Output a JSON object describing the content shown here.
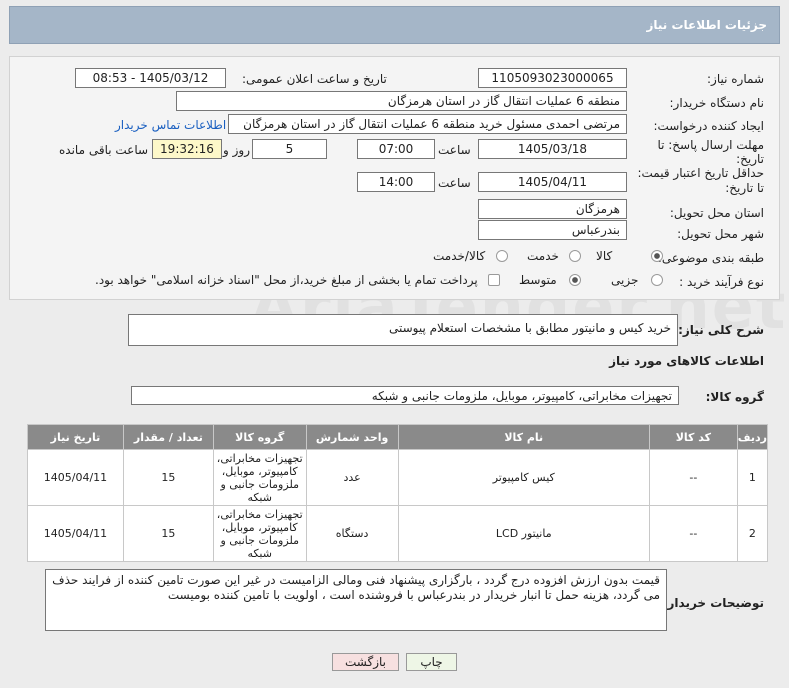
{
  "header": {
    "title": "جزئیات اطلاعات نیاز"
  },
  "form": {
    "need_number_label": "شماره نیاز:",
    "need_number": "1105093023000065",
    "announce_label": "تاریخ و ساعت اعلان عمومی:",
    "announce_value": "1405/03/12 - 08:53",
    "buyer_org_label": "نام دستگاه خریدار:",
    "buyer_org": "منطقه 6 عملیات انتقال گاز در استان هرمزگان",
    "creator_label": "ایجاد کننده درخواست:",
    "creator": "مرتضی احمدی مسئول خرید منطقه 6 عملیات انتقال گاز در استان هرمزگان",
    "contact_link": "اطلاعات تماس خریدار",
    "reply_label_1": "مهلت ارسال پاسخ: تا",
    "reply_label_2": "تاریخ:",
    "reply_date": "1405/03/18",
    "time_label": "ساعت",
    "reply_time": "07:00",
    "days_value": "5",
    "days_label": "روز و",
    "remaining_time": "19:32:16",
    "remaining_label": "ساعت باقی مانده",
    "validity_label_1": "حداقل تاریخ اعتبار قیمت:",
    "validity_label_2": "تا تاریخ:",
    "validity_date": "1405/04/11",
    "validity_time": "14:00",
    "province_label": "استان محل تحویل:",
    "province": "هرمزگان",
    "city_label": "شهر محل تحویل:",
    "city": "بندرعباس",
    "category_label": "طبقه بندی موضوعی:",
    "category_options": [
      "کالا",
      "خدمت",
      "کالا/خدمت"
    ],
    "process_label": "نوع فرآیند خرید :",
    "process_options": [
      "جزیی",
      "متوسط"
    ],
    "payment_note": "پرداخت تمام یا بخشی از مبلغ خرید،از محل \"اسناد خزانه اسلامی\" خواهد بود."
  },
  "summary": {
    "label": "شرح کلی نیاز:",
    "text": "خرید کیس و مانیتور مطابق با مشخصات استعلام پیوستی"
  },
  "goods_info": {
    "title": "اطلاعات کالاهای مورد نیاز",
    "group_label": "گروه کالا:",
    "group_value": "تجهیزات مخابراتی، کامپیوتر، موبایل، ملزومات جانبی و شبکه"
  },
  "table": {
    "headers": [
      "ردیف",
      "کد کالا",
      "نام کالا",
      "واحد شمارش",
      "گروه کالا",
      "تعداد / مقدار",
      "تاریخ نیاز"
    ],
    "rows": [
      {
        "row": "1",
        "code": "--",
        "name": "کیس کامپیوتر",
        "unit": "عدد",
        "group": "تجهیزات مخابراتی، کامپیوتر، موبایل، ملزومات جانبی و شبکه",
        "qty": "15",
        "date": "1405/04/11"
      },
      {
        "row": "2",
        "code": "--",
        "name": "مانیتور LCD",
        "unit": "دستگاه",
        "group": "تجهیزات مخابراتی، کامپیوتر، موبایل، ملزومات جانبی و شبکه",
        "qty": "15",
        "date": "1405/04/11"
      }
    ]
  },
  "buyer_notes": {
    "label": "توضیحات خریدار:",
    "text": "قیمت بدون ارزش افزوده درج گردد ، بارگزاری پیشنهاد فنی ومالی الزامیست در غیر این صورت تامین کننده از فرایند حذف می گردد، هزینه حمل تا انبار خریدار در بندرعباس با فروشنده است ، اولویت با تامین کننده بومیست"
  },
  "buttons": {
    "print": "چاپ",
    "back": "بازگشت"
  },
  "watermark": "AriaTender.net"
}
